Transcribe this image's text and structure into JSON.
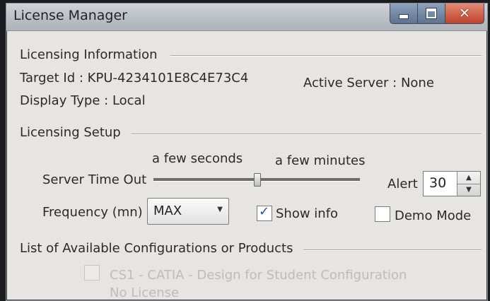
{
  "window": {
    "title": "License Manager"
  },
  "licensing_info": {
    "header": "Licensing Information",
    "target_id_label": "Target Id :",
    "target_id_value": "KPU-4234101E8C4E73C4",
    "active_server_label": "Active Server :",
    "active_server_value": "None",
    "display_type_label": "Display Type :",
    "display_type_value": "Local"
  },
  "licensing_setup": {
    "header": "Licensing Setup",
    "slider_left_label": "a few seconds",
    "slider_right_label": "a few minutes",
    "server_timeout_label": "Server Time Out",
    "server_timeout_level": 0.52,
    "alert_label": "Alert",
    "alert_value": "30",
    "frequency_label": "Frequency (mn)",
    "frequency_value": "MAX",
    "show_info_label": "Show info",
    "show_info_checked": true,
    "demo_mode_label": "Demo Mode",
    "demo_mode_checked": false
  },
  "configurations": {
    "header": "List of Available Configurations or Products",
    "items": [
      {
        "label": "CS1 - CATIA - Design for Student Configuration",
        "sub": "No License"
      }
    ]
  },
  "icons": {
    "minimize": "minimize-icon",
    "maximize": "maximize-icon",
    "close": "close-icon",
    "check": "checkmark-icon",
    "dropdown": "chevron-down-icon",
    "spin_up": "arrow-up-icon",
    "spin_down": "arrow-down-icon"
  }
}
